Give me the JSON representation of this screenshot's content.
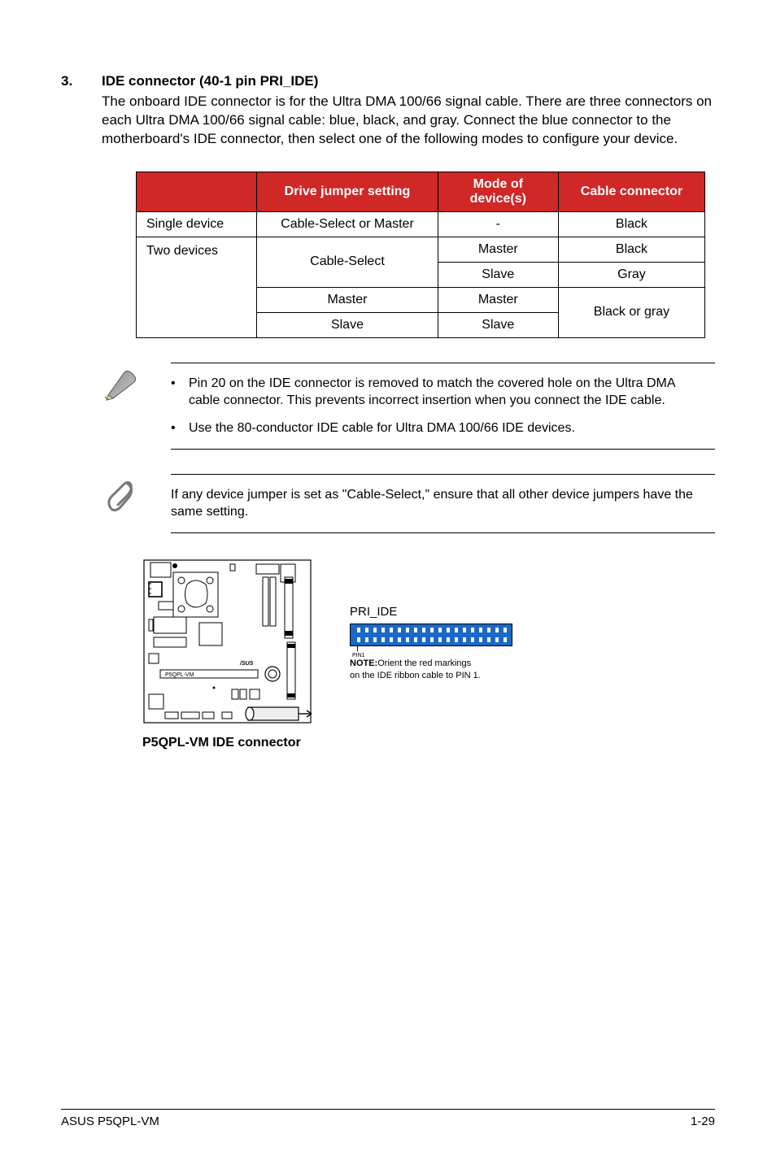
{
  "section": {
    "number": "3.",
    "heading": "IDE connector (40-1 pin PRI_IDE)",
    "body": "The onboard IDE connector is for the Ultra DMA 100/66 signal cable. There are three connectors on each Ultra DMA 100/66 signal cable: blue, black, and gray. Connect the blue connector to the motherboard's IDE connector, then select one of the following modes to configure your device."
  },
  "table": {
    "headers": {
      "c1": "",
      "c2": "Drive jumper setting",
      "c3": "Mode of device(s)",
      "c4": "Cable connector"
    },
    "rows": [
      {
        "c1": "Single device",
        "c2": "Cable-Select or Master",
        "c3": "-",
        "c4": "Black"
      },
      {
        "c1": "Two devices",
        "c2": "Cable-Select",
        "c3": "Master",
        "c4": "Black"
      },
      {
        "c1": "",
        "c2": "",
        "c3": "Slave",
        "c4": "Gray"
      },
      {
        "c1": "",
        "c2": "Master",
        "c3": "Master",
        "c4": "Black or gray"
      },
      {
        "c1": "",
        "c2": "Slave",
        "c3": "Slave",
        "c4": ""
      }
    ]
  },
  "notes": {
    "pencil_items": [
      "Pin 20 on the IDE connector is removed to match the covered hole on the Ultra DMA cable connector. This prevents incorrect insertion when you connect the IDE cable.",
      "Use the 80-conductor IDE cable for Ultra DMA 100/66 IDE devices."
    ],
    "paperclip": "If any device jumper is set as \"Cable-Select,\" ensure that all other device jumpers have the same setting."
  },
  "diagram": {
    "mobo_label": "P5QPL-VM",
    "pri_ide_label": "PRI_IDE",
    "pin1_label": "PIN1",
    "note_bold": "NOTE:",
    "note_rest_l1": "Orient the red markings",
    "note_rest_l2": "on the IDE ribbon cable to PIN 1.",
    "caption": "P5QPL-VM IDE connector"
  },
  "footer": {
    "left": "ASUS P5QPL-VM",
    "right": "1-29"
  }
}
